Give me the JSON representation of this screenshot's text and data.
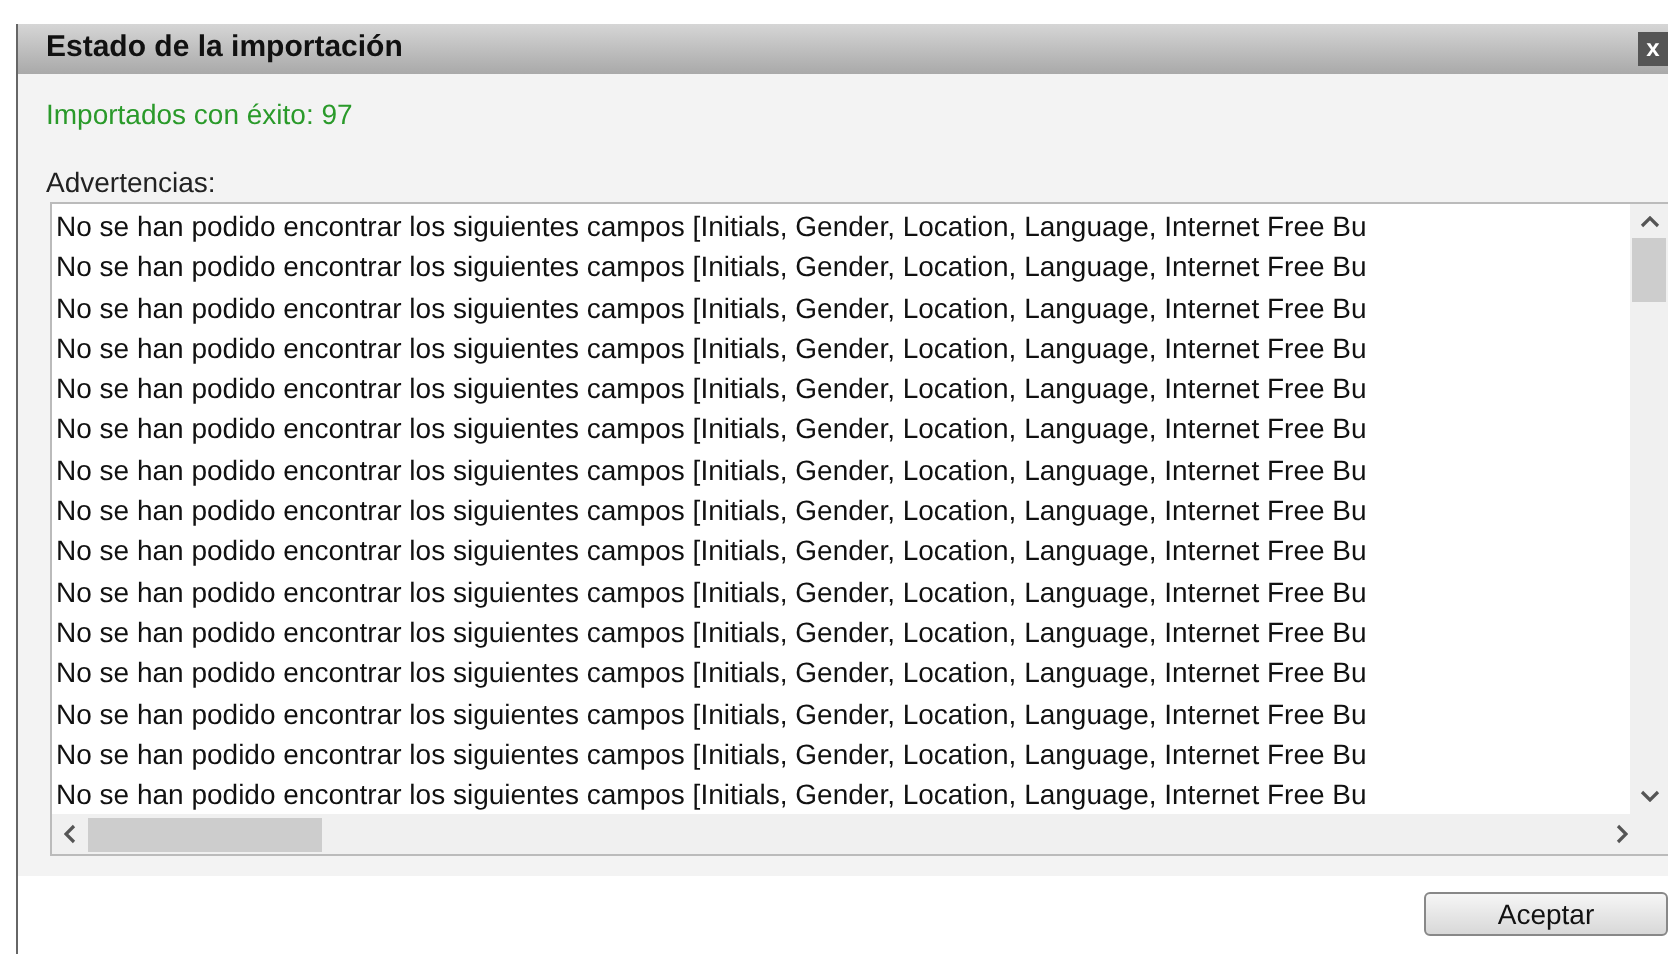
{
  "window": {
    "title": "Estado de la importación",
    "close": "x"
  },
  "success": "Importados con éxito: 97",
  "warnings_label": "Advertencias:",
  "warnings": [
    "No se han podido encontrar los siguientes campos [Initials, Gender, Location, Language, Internet Free Bu",
    "No se han podido encontrar los siguientes campos [Initials, Gender, Location, Language, Internet Free Bu",
    "No se han podido encontrar los siguientes campos [Initials, Gender, Location, Language, Internet Free Bu",
    "No se han podido encontrar los siguientes campos [Initials, Gender, Location, Language, Internet Free Bu",
    "No se han podido encontrar los siguientes campos [Initials, Gender, Location, Language, Internet Free Bu",
    "No se han podido encontrar los siguientes campos [Initials, Gender, Location, Language, Internet Free Bu",
    "No se han podido encontrar los siguientes campos [Initials, Gender, Location, Language, Internet Free Bu",
    "No se han podido encontrar los siguientes campos [Initials, Gender, Location, Language, Internet Free Bu",
    "No se han podido encontrar los siguientes campos [Initials, Gender, Location, Language, Internet Free Bu",
    "No se han podido encontrar los siguientes campos [Initials, Gender, Location, Language, Internet Free Bu",
    "No se han podido encontrar los siguientes campos [Initials, Gender, Location, Language, Internet Free Bu",
    "No se han podido encontrar los siguientes campos [Initials, Gender, Location, Language, Internet Free Bu",
    "No se han podido encontrar los siguientes campos [Initials, Gender, Location, Language, Internet Free Bu",
    "No se han podido encontrar los siguientes campos [Initials, Gender, Location, Language, Internet Free Bu",
    "No se han podido encontrar los siguientes campos [Initials, Gender, Location, Language, Internet Free Bu"
  ],
  "buttons": [
    "Aceptar"
  ]
}
